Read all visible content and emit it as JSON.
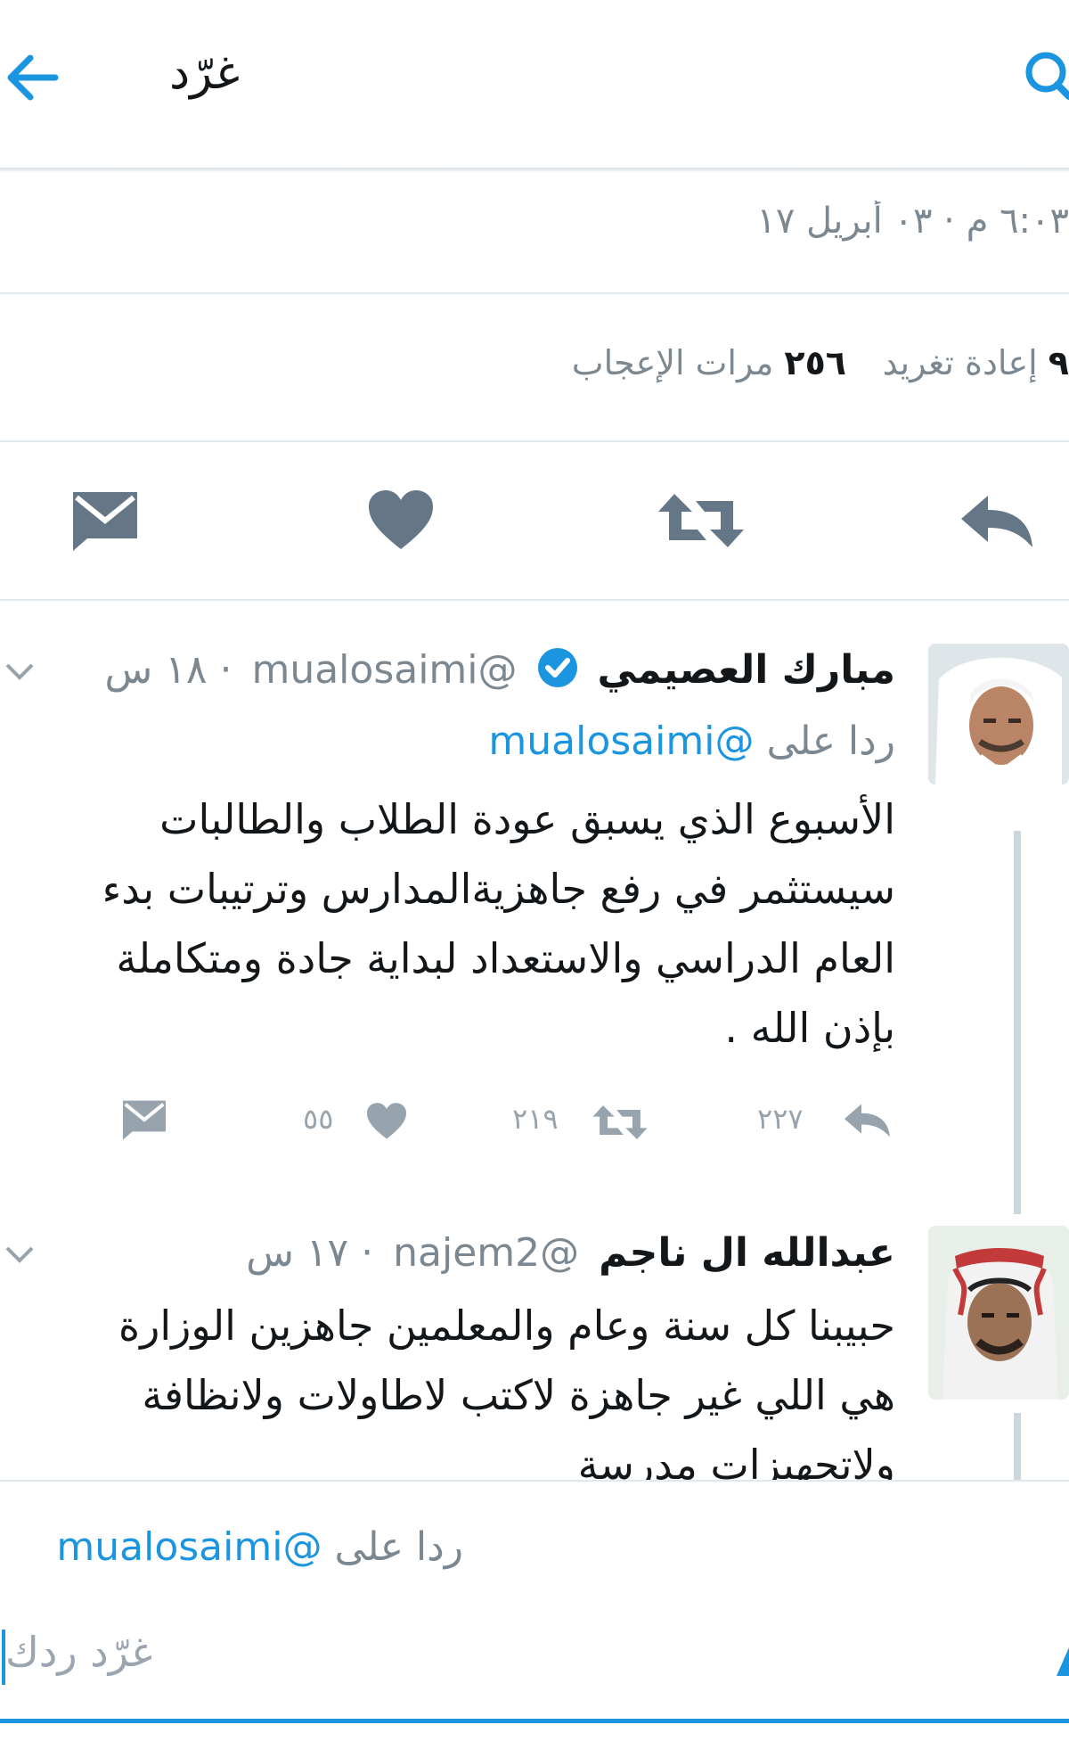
{
  "header": {
    "title": "غرّد",
    "back_icon": "arrow-left-icon",
    "search_icon": "search-icon"
  },
  "tweet_meta": {
    "timestamp": "٦:٠٣ م · ٠٣ أبريل ١٧"
  },
  "stats": {
    "retweets_count": "٩",
    "retweets_label": "إعادة تغريد",
    "likes_count": "٢٥٦",
    "likes_label": "مرات الإعجاب"
  },
  "actions": {
    "reply_icon": "reply-icon",
    "retweet_icon": "retweet-icon",
    "like_icon": "heart-icon",
    "message_icon": "mail-icon"
  },
  "replies": [
    {
      "name": "مبارك العصيمي",
      "verified": true,
      "handle": "@mualosaimi",
      "time": "· ١٨ س",
      "reply_to_prefix": "ردا على",
      "reply_to_handle": "@mualosaimi",
      "lines": [
        "الأسبوع الذي يسبق عودة الطلاب والطالبات",
        "سيستثمر في رفع جاهزيةالمدارس وترتيبات بدء",
        "العام الدراسي والاستعداد لبداية جادة ومتكاملة",
        "بإذن الله ."
      ],
      "reply_count": "٢٢٧",
      "retweet_count": "٢١٩",
      "like_count": "٥٥"
    },
    {
      "name": "عبدالله ال ناجم",
      "verified": false,
      "handle": "@najem2",
      "time": "· ١٧ س",
      "lines": [
        "حبيبنا كل سنة وعام والمعلمين جاهزين الوزارة",
        "هي اللي غير جاهزة لاكتب  لاطاولات ولانظافة",
        "ولاتجهيزات مدرسة"
      ]
    }
  ],
  "composer": {
    "reply_to_prefix": "ردا على",
    "reply_to_handle": "@mualosaimi",
    "placeholder": "غرّد ردك"
  },
  "colors": {
    "accent": "#1b95e0",
    "icon_gray": "#657786",
    "divider": "#e1e8ed"
  }
}
